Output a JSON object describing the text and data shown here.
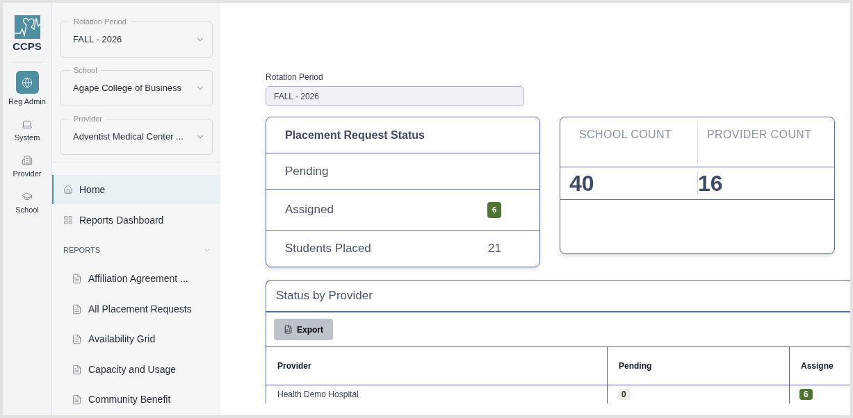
{
  "logo": {
    "text": "CCPS"
  },
  "rail": [
    {
      "label": "Reg Admin",
      "selected": true
    },
    {
      "label": "System",
      "selected": false
    },
    {
      "label": "Provider",
      "selected": false
    },
    {
      "label": "School",
      "selected": false
    }
  ],
  "filters": [
    {
      "label": "Rotation Period",
      "value": "FALL - 2026"
    },
    {
      "label": "School",
      "value": "Agape College of Business"
    },
    {
      "label": "Provider",
      "value": "Adventist Medical Center ..."
    }
  ],
  "nav": [
    {
      "label": "Home",
      "selected": true
    },
    {
      "label": "Reports Dashboard",
      "selected": false
    }
  ],
  "reports": {
    "title": "REPORTS",
    "expanded": true,
    "items": [
      "Affiliation Agreement ...",
      "All Placement Requests",
      "Availability Grid",
      "Capacity and Usage",
      "Community Benefit"
    ]
  },
  "rotation_period": {
    "label": "Rotation Period",
    "value": "FALL - 2026"
  },
  "placement_status": {
    "title": "Placement Request Status",
    "rows": [
      {
        "label": "Pending",
        "kind": "empty"
      },
      {
        "label": "Assigned",
        "kind": "badge",
        "value": "6"
      },
      {
        "label": "Students Placed",
        "kind": "plain",
        "value": "21"
      }
    ]
  },
  "counts": [
    {
      "label": "SCHOOL COUNT",
      "value": "40"
    },
    {
      "label": "PROVIDER COUNT",
      "value": "16"
    }
  ],
  "status_by_provider": {
    "title": "Status by Provider",
    "export_button": "Export",
    "columns": [
      "Provider",
      "Pending",
      "Assigne"
    ],
    "rows": [
      {
        "cells": [
          {
            "value": "Health Demo Hospital",
            "kind": "text"
          },
          {
            "value": "0",
            "kind": "neutral"
          },
          {
            "value": "6",
            "kind": "success"
          }
        ]
      }
    ]
  }
}
